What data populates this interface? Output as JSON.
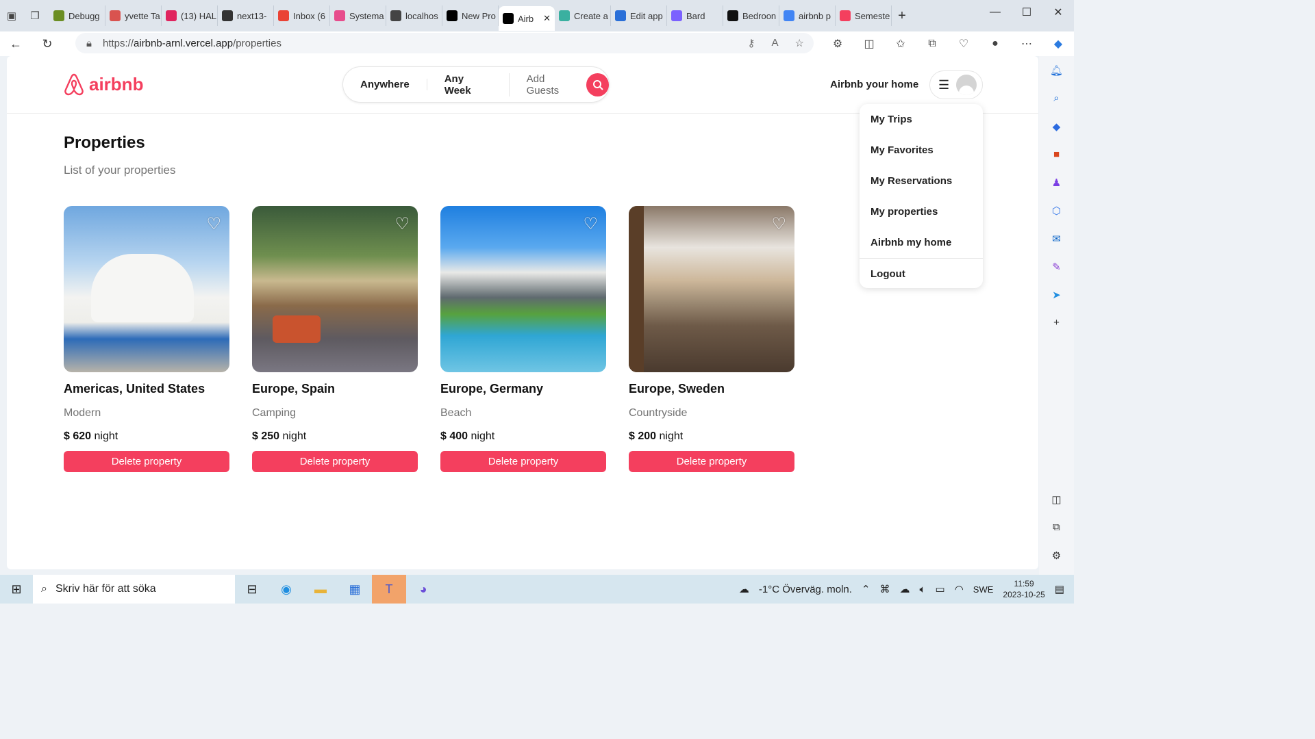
{
  "browser": {
    "tabs": [
      {
        "label": "Debugg",
        "color": "#6b8e23"
      },
      {
        "label": "yvette Ta",
        "color": "#d9534f"
      },
      {
        "label": "(13) HAL",
        "color": "#e0245e"
      },
      {
        "label": "next13-",
        "color": "#333333"
      },
      {
        "label": "Inbox (6",
        "color": "#ea4335"
      },
      {
        "label": "Systema",
        "color": "#e74c8c"
      },
      {
        "label": "localhos",
        "color": "#444444"
      },
      {
        "label": "New Pro",
        "color": "#000000"
      },
      {
        "label": "Airb",
        "color": "#000000",
        "active": true
      },
      {
        "label": "Create a",
        "color": "#3ab0a0"
      },
      {
        "label": "Edit app",
        "color": "#2a6fd8"
      },
      {
        "label": "Bard",
        "color": "#7b61ff"
      },
      {
        "label": "Bedroon",
        "color": "#111111"
      },
      {
        "label": "airbnb p",
        "color": "#4285f4"
      },
      {
        "label": "Semeste",
        "color": "#f43f5e"
      }
    ],
    "url_prefix": "https://",
    "url_host": "airbnb-arnl.vercel.app",
    "url_path": "/properties"
  },
  "site": {
    "logo_text": "airbnb",
    "search": {
      "where": "Anywhere",
      "when": "Any Week",
      "guests": "Add Guests"
    },
    "host_link": "Airbnb your home",
    "menu": [
      "My Trips",
      "My Favorites",
      "My Reservations",
      "My properties",
      "Airbnb my home"
    ],
    "logout": "Logout",
    "brand_color": "#f43f5e"
  },
  "page": {
    "title": "Properties",
    "subtitle": "List of your properties",
    "properties": [
      {
        "location": "Americas, United States",
        "category": "Modern",
        "price": "$ 620",
        "unit": "night",
        "action": "Delete property"
      },
      {
        "location": "Europe, Spain",
        "category": "Camping",
        "price": "$ 250",
        "unit": "night",
        "action": "Delete property"
      },
      {
        "location": "Europe, Germany",
        "category": "Beach",
        "price": "$ 400",
        "unit": "night",
        "action": "Delete property"
      },
      {
        "location": "Europe, Sweden",
        "category": "Countryside",
        "price": "$ 200",
        "unit": "night",
        "action": "Delete property"
      }
    ]
  },
  "taskbar": {
    "search_placeholder": "Skriv här för att söka",
    "weather": "-1°C  Överväg. moln.",
    "lang": "SWE",
    "time": "11:59",
    "date": "2023-10-25"
  }
}
